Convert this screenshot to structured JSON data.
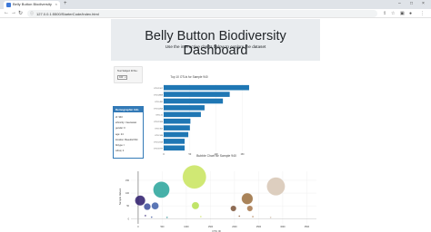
{
  "browser": {
    "tab_title": "Belly Button Biodiversity",
    "url": "127.0.0.1:5500/StarterCode/index.html"
  },
  "header": {
    "title": "Belly Button Biodiversity Dashboard",
    "subtitle": "Use the interactive charts below to explore the dataset"
  },
  "selector": {
    "label": "Test Subject ID No.:",
    "value": "940"
  },
  "demographic": {
    "heading": "Demographic Info",
    "lines": [
      "id: 940",
      "ethnicity: Caucasian",
      "gender: F",
      "age: 24",
      "location: Beaufort/NC",
      "bbtype: I",
      "wfreq: 2"
    ]
  },
  "chart_data": [
    {
      "type": "bar",
      "orientation": "horizontal",
      "title": "Top 10 OTUs for Sample 940",
      "categories": [
        "OTU 1167",
        "OTU 2859",
        "OTU 482",
        "OTU 2264",
        "OTU 41",
        "OTU 1189",
        "OTU 352",
        "OTU 189",
        "OTU 2318",
        "OTU 1977"
      ],
      "values": [
        163,
        126,
        113,
        78,
        71,
        51,
        50,
        47,
        40,
        40
      ],
      "x_ticks": [
        "0",
        "50",
        "100",
        "150"
      ],
      "xlim": [
        0,
        170
      ],
      "color": "#1f77b4"
    },
    {
      "type": "scatter",
      "title": "Bubble Chart for Sample 940",
      "xlabel": "OTU ID",
      "ylabel": "Sample Values",
      "x_ticks": [
        "0",
        "500",
        "1000",
        "1500",
        "2000",
        "2500",
        "3000",
        "3500"
      ],
      "y_ticks": [
        "0",
        "50",
        "100",
        "150"
      ],
      "xlim": [
        -150,
        3700
      ],
      "ylim": [
        -20,
        185
      ],
      "points": [
        {
          "x": 41,
          "y": 71,
          "color": "#2b1a6b"
        },
        {
          "x": 189,
          "y": 47,
          "color": "#3b4b9b"
        },
        {
          "x": 352,
          "y": 50,
          "color": "#3e5ea8"
        },
        {
          "x": 482,
          "y": 113,
          "color": "#27a39a"
        },
        {
          "x": 150,
          "y": 12,
          "color": "#3c2f7a"
        },
        {
          "x": 280,
          "y": 6,
          "color": "#3a4f98"
        },
        {
          "x": 600,
          "y": 5,
          "color": "#2a8f93"
        },
        {
          "x": 1167,
          "y": 163,
          "color": "#c8e45c"
        },
        {
          "x": 1189,
          "y": 51,
          "color": "#b5df4e"
        },
        {
          "x": 1300,
          "y": 8,
          "color": "#cfe66a"
        },
        {
          "x": 1977,
          "y": 40,
          "color": "#7a5236"
        },
        {
          "x": 2264,
          "y": 78,
          "color": "#9a6d3c"
        },
        {
          "x": 2318,
          "y": 40,
          "color": "#a6764a"
        },
        {
          "x": 2100,
          "y": 10,
          "color": "#8a5b33"
        },
        {
          "x": 2380,
          "y": 8,
          "color": "#b07e50"
        },
        {
          "x": 2859,
          "y": 126,
          "color": "#d7c6b4"
        },
        {
          "x": 2750,
          "y": 5,
          "color": "#cbb9a6"
        }
      ]
    }
  ]
}
